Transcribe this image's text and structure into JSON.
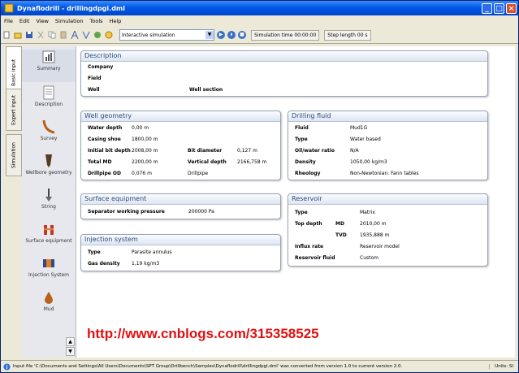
{
  "window": {
    "title": "Dynaflodrill - drillingdpgi.dml"
  },
  "menu": [
    "File",
    "Edit",
    "View",
    "Simulation",
    "Tools",
    "Help"
  ],
  "toolbar": {
    "mode_value": "Interactive simulation",
    "simulation_time": "Simulation time 00:00:00",
    "step_length": "Step length 00 s"
  },
  "left_tabs": [
    "Basic input",
    "Expert input",
    "Simulation"
  ],
  "sidebar": {
    "items": [
      {
        "label": "Summary",
        "icon": "summary-icon"
      },
      {
        "label": "Description",
        "icon": "description-icon"
      },
      {
        "label": "Survey",
        "icon": "survey-icon"
      },
      {
        "label": "Wellbore geometry",
        "icon": "wellbore-icon"
      },
      {
        "label": "String",
        "icon": "string-icon"
      },
      {
        "label": "Surface equipment",
        "icon": "surface-equipment-icon"
      },
      {
        "label": "Injection System",
        "icon": "injection-system-icon"
      },
      {
        "label": "Mud",
        "icon": "mud-icon"
      }
    ]
  },
  "description": {
    "title": "Description",
    "company_label": "Company",
    "field_label": "Field",
    "well_label": "Well",
    "well_section_label": "Well section"
  },
  "well_geometry": {
    "title": "Well geometry",
    "water_depth_label": "Water depth",
    "water_depth": "0,00 m",
    "casing_shoe_label": "Casing shoe",
    "casing_shoe": "1800,00 m",
    "initial_bit_depth_label": "Initial bit depth",
    "initial_bit_depth": "2008,00 m",
    "bit_diameter_label": "Bit diameter",
    "bit_diameter": "0,127 m",
    "total_md_label": "Total MD",
    "total_md": "2200,00 m",
    "vertical_depth_label": "Vertical depth",
    "vertical_depth": "2166,758 m",
    "drillpipe_od_label": "Drillpipe OD",
    "drillpipe_od": "0,076 m",
    "drillpipe_value": "Drillpipe"
  },
  "drilling_fluid": {
    "title": "Drilling fluid",
    "fluid_label": "Fluid",
    "fluid": "Mud1G",
    "type_label": "Type",
    "type": "Water based",
    "oil_water_label": "Oil/water ratio",
    "oil_water": "N/A",
    "density_label": "Density",
    "density": "1050,00 kg/m3",
    "rheology_label": "Rheology",
    "rheology": "Non-Newtonian: Fann tables"
  },
  "surface_equipment": {
    "title": "Surface equipment",
    "separator_label": "Separator working pressure",
    "separator": "200000 Pa"
  },
  "reservoir": {
    "title": "Reservoir",
    "type_label": "Type",
    "type": "Matrix",
    "top_depth_label": "Top depth",
    "md_label": "MD",
    "md": "2010,00 m",
    "tvd_label": "TVD",
    "tvd": "1935,888 m",
    "influx_label": "Influx rate",
    "influx": "Reservoir model",
    "reservoir_fluid_label": "Reservoir fluid",
    "reservoir_fluid": "Custom"
  },
  "injection_system": {
    "title": "Injection system",
    "type_label": "Type",
    "type": "Parasite annulus",
    "gas_density_label": "Gas density",
    "gas_density": "1,19 kg/m3"
  },
  "watermark": "http://www.cnblogs.com/315358525",
  "status": {
    "message": "Input file 'C:\\Documents and Settings\\All Users\\Documents\\SPT Group\\Drillbench\\Samples\\Dynaflodrill\\drillingdpgi.dml' was converted from version 1.0 to current version 2.0.",
    "units": "Units: SI"
  }
}
